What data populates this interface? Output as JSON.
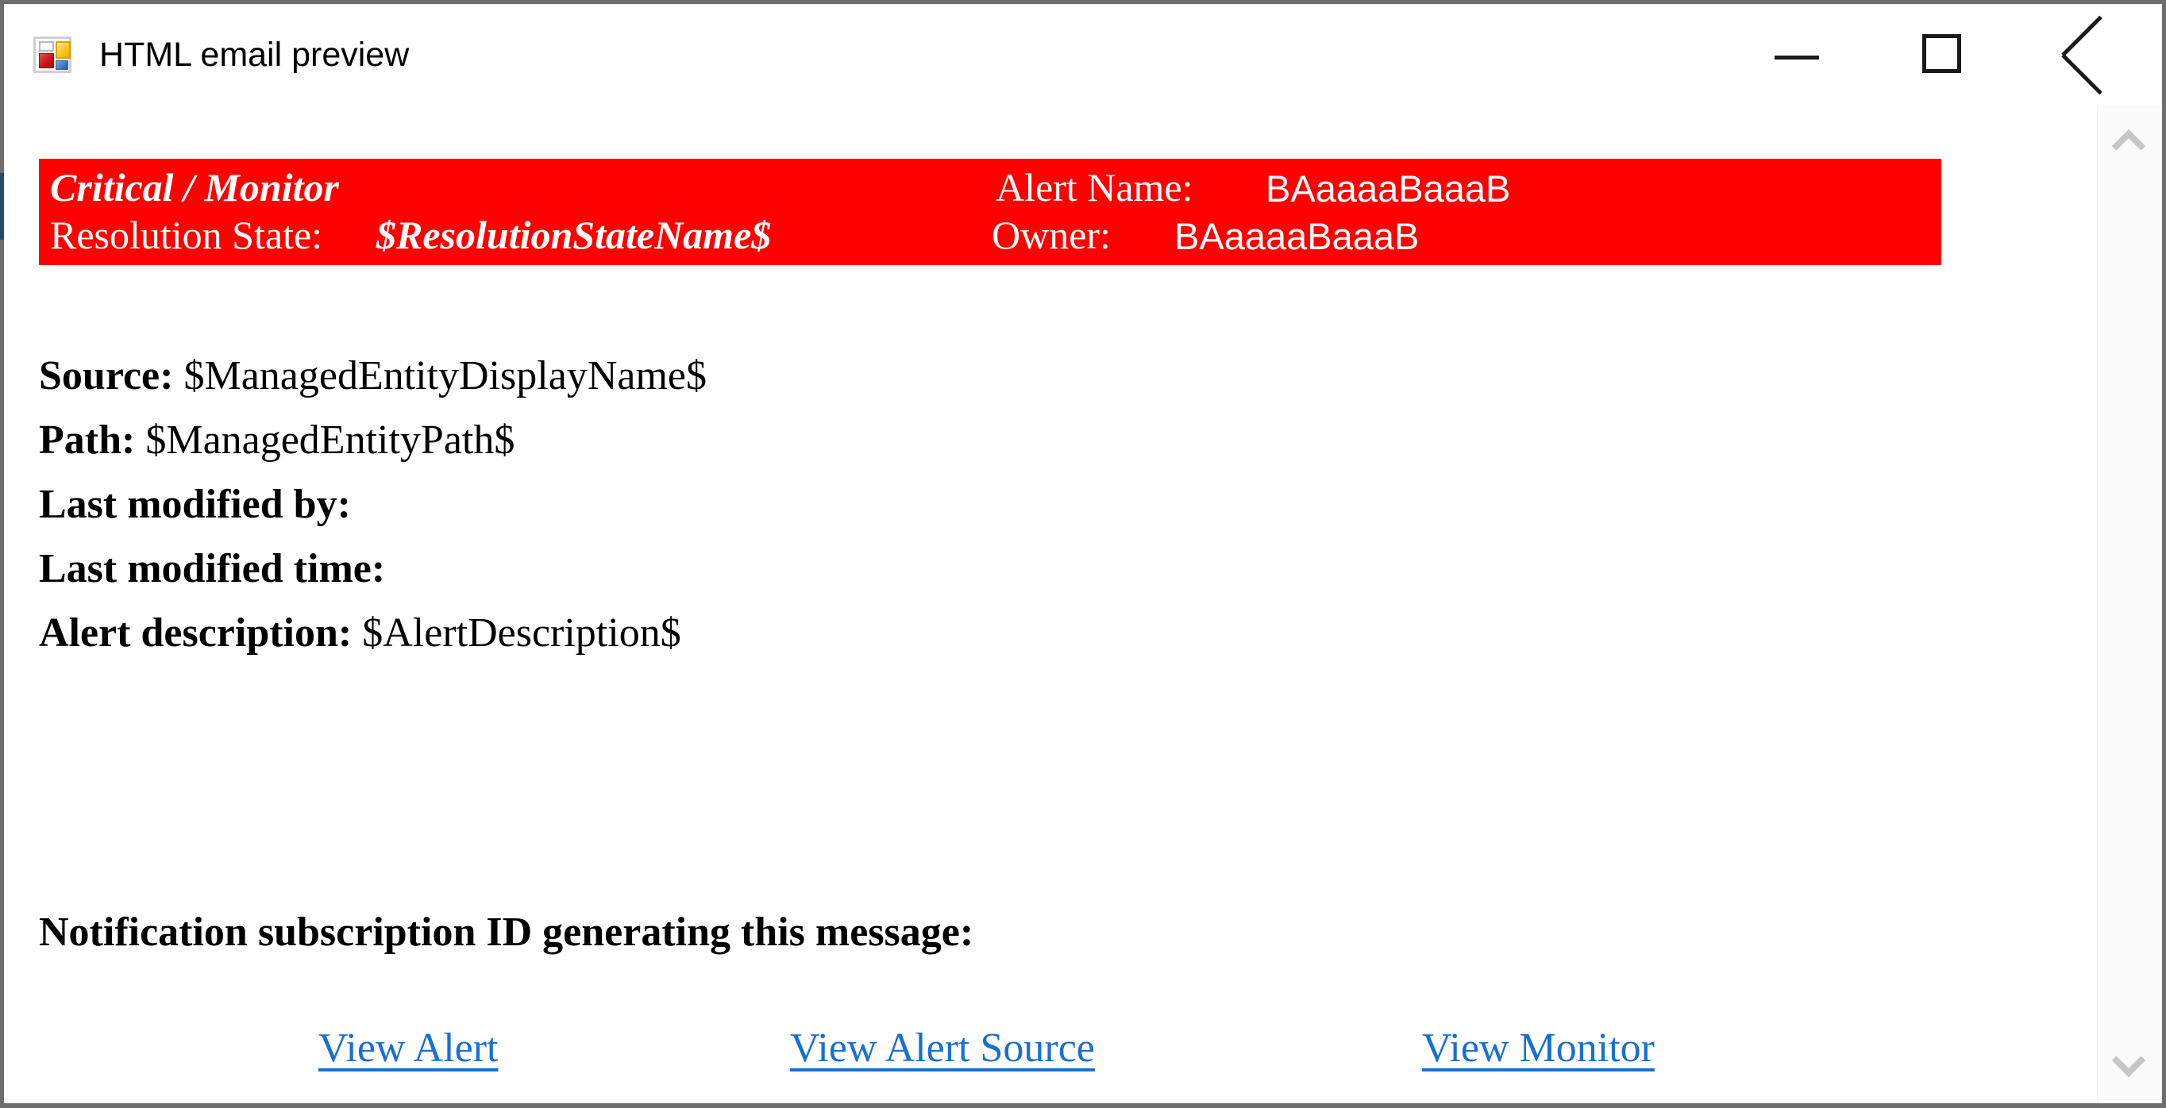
{
  "window": {
    "title": "HTML email preview",
    "icon": "windows-forms-preview-icon",
    "controls": {
      "minimize": "minimize-icon",
      "maximize": "maximize-icon",
      "close": "close-icon"
    }
  },
  "alert_banner": {
    "background_color": "#FF0000",
    "text_color": "#FFFFFF",
    "severity": "Critical / Monitor",
    "alert_name_label": "Alert Name:",
    "alert_name_value": "BAaaaaBaaaB",
    "resolution_state_label": "Resolution State:",
    "resolution_state_value": "$ResolutionStateName$",
    "owner_label": "Owner:",
    "owner_value": "BAaaaaBaaaB"
  },
  "details": [
    {
      "label": "Source:",
      "value": "$ManagedEntityDisplayName$"
    },
    {
      "label": "Path:",
      "value": "$ManagedEntityPath$"
    },
    {
      "label": "Last modified by:",
      "value": ""
    },
    {
      "label": "Last modified time:",
      "value": ""
    },
    {
      "label": "Alert description:",
      "value": "$AlertDescription$"
    }
  ],
  "notification": {
    "heading": "Notification subscription ID generating this message:"
  },
  "links": [
    {
      "label": "View Alert"
    },
    {
      "label": "View Alert Source"
    },
    {
      "label": "View Monitor"
    }
  ],
  "scrollbar": {
    "up_icon": "chevron-up-icon",
    "down_icon": "chevron-down-icon"
  },
  "colors": {
    "link": "#1A6FD4",
    "alert": "#FF0000",
    "frame": "#6E6E6E",
    "accent": "#2C4760"
  }
}
